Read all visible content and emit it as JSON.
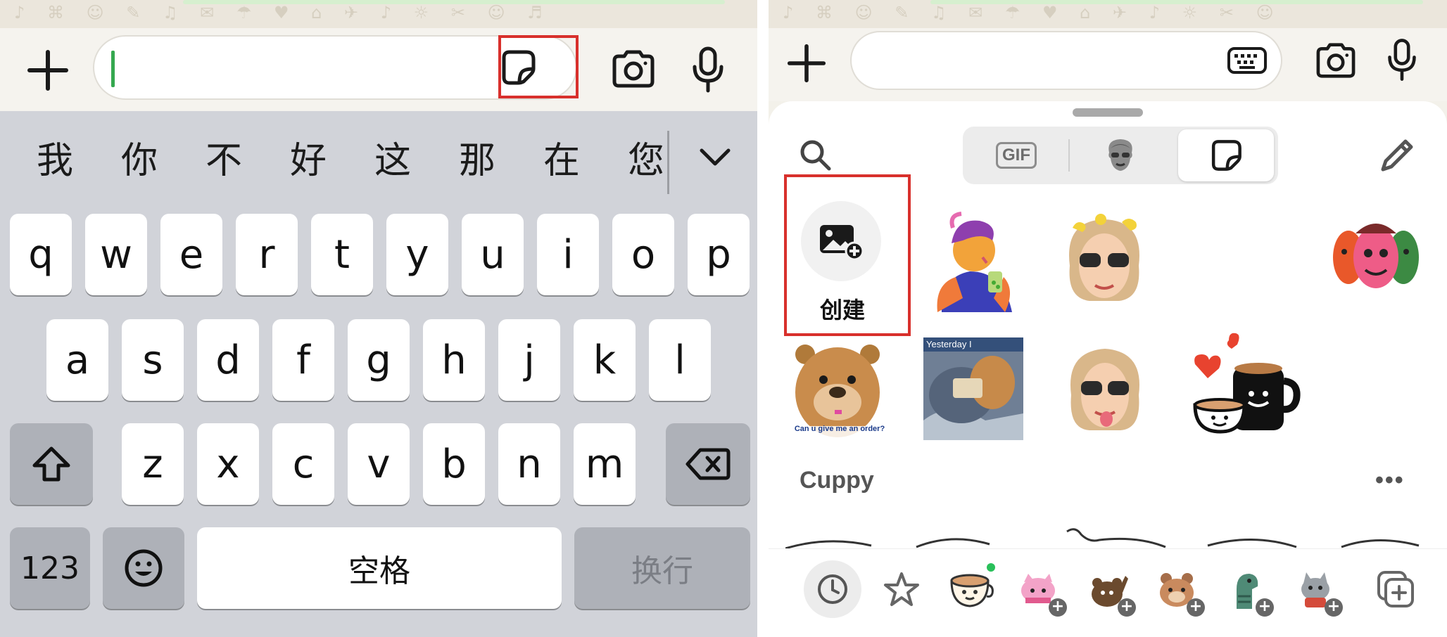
{
  "left_screen": {
    "input": {
      "value": ""
    },
    "candidates": [
      "我",
      "你",
      "不",
      "好",
      "这",
      "那",
      "在",
      "您"
    ],
    "keyboard": {
      "row1": [
        "q",
        "w",
        "e",
        "r",
        "t",
        "y",
        "u",
        "i",
        "o",
        "p"
      ],
      "row2": [
        "a",
        "s",
        "d",
        "f",
        "g",
        "h",
        "j",
        "k",
        "l"
      ],
      "row3": [
        "z",
        "x",
        "c",
        "v",
        "b",
        "n",
        "m"
      ],
      "numbers_key": "123",
      "space_key": "空格",
      "return_key": "换行"
    },
    "icons": {
      "attach": "plus-icon",
      "sticker": "sticker-icon",
      "camera": "camera-icon",
      "mic": "microphone-icon",
      "more_candidates": "chevron-down-icon",
      "shift": "shift-icon",
      "delete": "backspace-icon",
      "emoji": "emoji-icon"
    },
    "highlight_color": "#d8302c"
  },
  "right_screen": {
    "picker_tabs": [
      {
        "label": "GIF",
        "selected": false
      },
      {
        "icon": "avatar-icon",
        "selected": false
      },
      {
        "icon": "sticker-icon",
        "selected": true
      }
    ],
    "create_label": "创建",
    "recent_stickers": [
      "woman-drinking-tea",
      "avatar-sunglasses-ducks",
      "three-faces",
      "cartoon-bear",
      "cat-with-note",
      "avatar-sunglasses-tongue",
      "coffee-cups-hearts"
    ],
    "sticker_texts": {
      "bear_caption": "Can u give me an order?",
      "cat_banner": "Yesterday I"
    },
    "section_title": "Cuppy",
    "more_label": "•••",
    "tray": [
      "recent-icon",
      "star-icon",
      "cuppy-pack",
      "pack-2",
      "pack-3",
      "pack-4",
      "pack-5",
      "pack-6",
      "add-pack-icon"
    ],
    "accent": {
      "highlight": "#d8302c",
      "new_indicator": "#29c05a"
    }
  }
}
